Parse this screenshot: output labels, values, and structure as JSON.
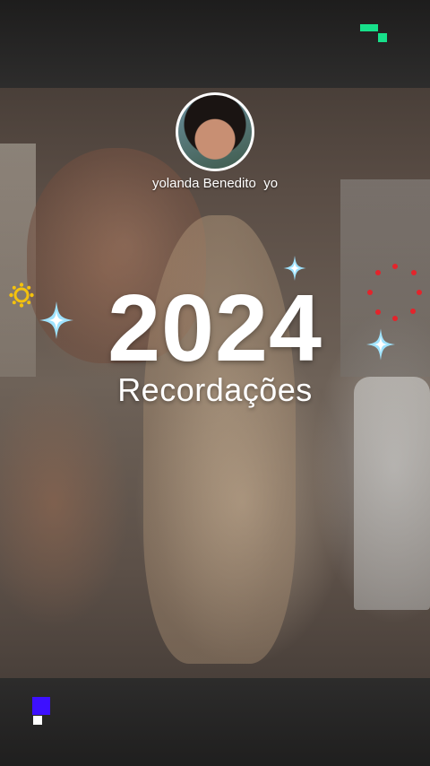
{
  "story": {
    "username": "yolanda Benedito  yo",
    "year": "2024",
    "subtitle": "Recordações"
  },
  "icons": {
    "top_right": "pixel-corner-icon",
    "bottom_left": "pixel-corner-icon",
    "sparkles": "sparkle-icon",
    "sun": "sun-icon",
    "fireworks": "firework-icon"
  },
  "colors": {
    "accent_green": "#17e08a",
    "accent_violet": "#3d10ff",
    "sparkle_blue": "#9fe3ff",
    "sun_yellow": "#f4c20d",
    "firework_red": "#e3242b"
  }
}
